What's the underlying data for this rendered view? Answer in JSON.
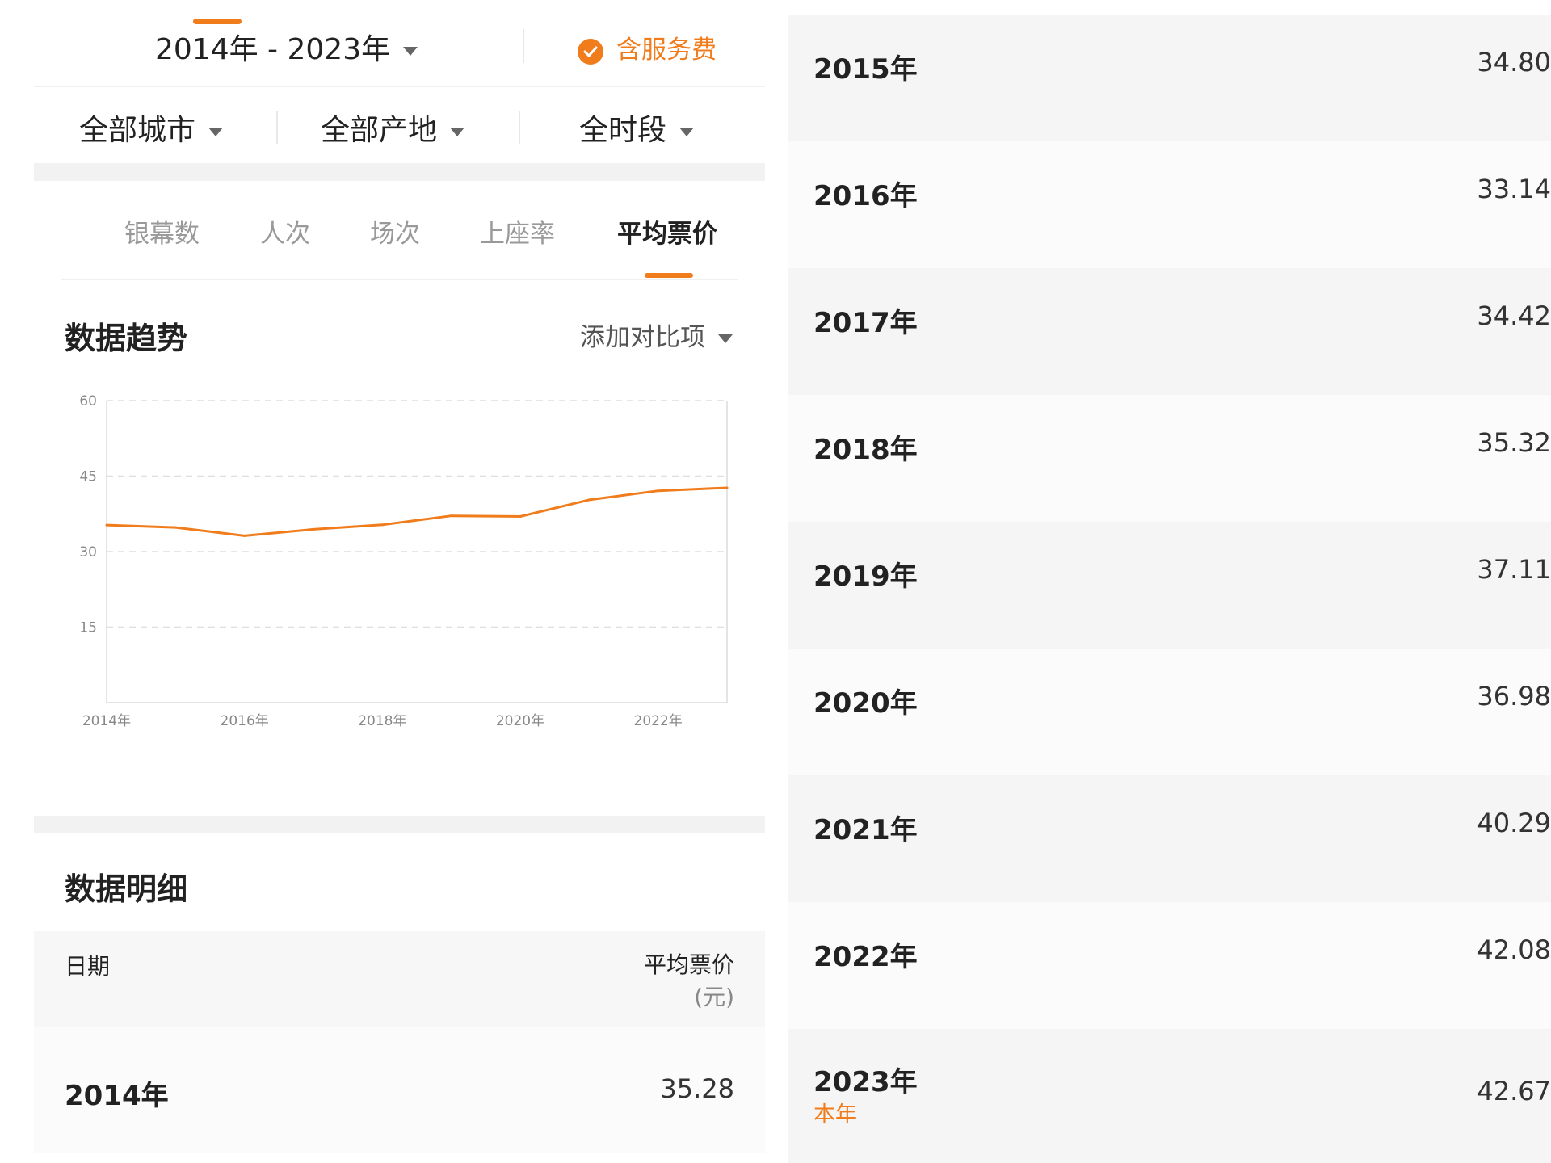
{
  "header": {
    "date_range": "2014年 - 2023年",
    "service_fee": "含服务费"
  },
  "filters": [
    {
      "label": "全部城市"
    },
    {
      "label": "全部产地"
    },
    {
      "label": "全时段"
    }
  ],
  "tabs": [
    {
      "label": "银幕数",
      "active": false
    },
    {
      "label": "人次",
      "active": false
    },
    {
      "label": "场次",
      "active": false
    },
    {
      "label": "上座率",
      "active": false
    },
    {
      "label": "平均票价",
      "active": true
    }
  ],
  "trend": {
    "title": "数据趋势",
    "compare_label": "添加对比项"
  },
  "chart_data": {
    "type": "line",
    "x": [
      "2014年",
      "2015年",
      "2016年",
      "2017年",
      "2018年",
      "2019年",
      "2020年",
      "2021年",
      "2022年",
      "2023年"
    ],
    "x_tick_labels": [
      "2014年",
      "2016年",
      "2018年",
      "2020年",
      "2022年"
    ],
    "series": [
      {
        "values": [
          35.28,
          34.8,
          33.14,
          34.42,
          35.32,
          37.11,
          36.98,
          40.29,
          42.08,
          42.67
        ]
      }
    ],
    "y_ticks": [
      15,
      30,
      45,
      60
    ],
    "ylim": [
      0,
      60
    ],
    "grid": true,
    "color": "#f07c1c"
  },
  "detail": {
    "title": "数据明细",
    "col_date": "日期",
    "col_value": "平均票价",
    "col_unit": "(元)",
    "rows": [
      {
        "year": "2014年",
        "value": "35.28"
      },
      {
        "year": "2015年",
        "value": "34.80"
      },
      {
        "year": "2016年",
        "value": "33.14"
      },
      {
        "year": "2017年",
        "value": "34.42"
      },
      {
        "year": "2018年",
        "value": "35.32"
      },
      {
        "year": "2019年",
        "value": "37.11"
      },
      {
        "year": "2020年",
        "value": "36.98"
      },
      {
        "year": "2021年",
        "value": "40.29"
      },
      {
        "year": "2022年",
        "value": "42.08"
      },
      {
        "year": "2023年",
        "value": "42.67",
        "tag": "本年"
      }
    ]
  },
  "colors": {
    "accent": "#f07c1c",
    "band": "#f2f2f2",
    "row_alt": "#f5f5f5"
  }
}
